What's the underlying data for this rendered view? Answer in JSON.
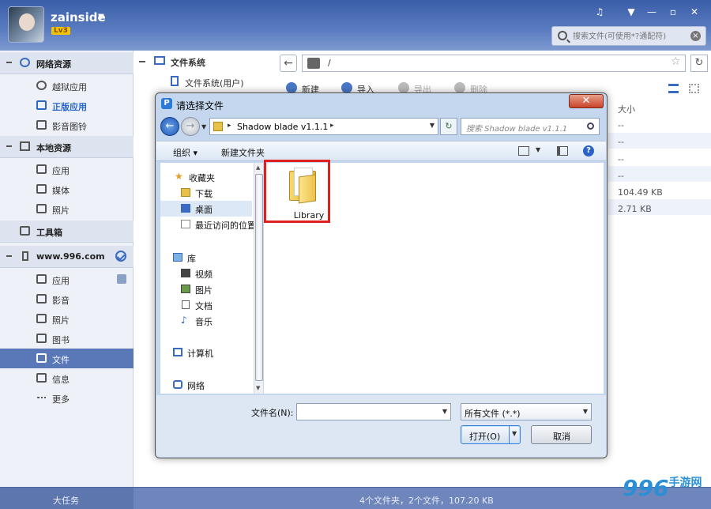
{
  "header": {
    "username": "zainside",
    "level": "Lv3",
    "search_placeholder": "搜索文件(可使用*?通配符)",
    "controls": [
      "music-icon",
      "menu-icon",
      "minimize-icon",
      "maximize-icon",
      "close-icon"
    ]
  },
  "sidebar": {
    "sections": [
      {
        "title": "网络资源",
        "items": [
          "越狱应用",
          "正版应用",
          "影音图铃"
        ]
      },
      {
        "title": "本地资源",
        "items": [
          "应用",
          "媒体",
          "照片"
        ]
      },
      {
        "title": "工具箱",
        "items": []
      },
      {
        "title": "www.996.com",
        "items": [
          "应用",
          "影音",
          "照片",
          "图书",
          "文件",
          "信息",
          "更多"
        ]
      }
    ],
    "active_item": "文件"
  },
  "tree": {
    "root": "文件系统",
    "child": "文件系统(用户)"
  },
  "address": {
    "path": "/"
  },
  "toolbar": {
    "new": "新建",
    "import": "导入",
    "export": "导出",
    "delete": "删除"
  },
  "list": {
    "size_header": "大小",
    "sizes": [
      "--",
      "--",
      "--",
      "--",
      "104.49 KB",
      "2.71 KB"
    ]
  },
  "status": {
    "left": "大任务",
    "summary": "4个文件夹，2个文件，107.20 KB"
  },
  "watermark": {
    "digits": "996",
    "text": "手游网"
  },
  "dialog": {
    "title": "请选择文件",
    "breadcrumb": "Shadow blade v1.1.1",
    "search_placeholder": "搜索 Shadow blade v1.1.1",
    "organize": "组织",
    "new_folder": "新建文件夹",
    "nav": {
      "favorites": "收藏夹",
      "downloads": "下载",
      "desktop": "桌面",
      "recent": "最近访问的位置",
      "libraries": "库",
      "videos": "视频",
      "pictures": "图片",
      "documents": "文档",
      "music": "音乐",
      "computer": "计算机",
      "network": "网络"
    },
    "folder_name": "Library",
    "filename_label": "文件名(N):",
    "filename_value": "",
    "filetype": "所有文件 (*.*)",
    "open": "打开(O)",
    "cancel": "取消"
  }
}
